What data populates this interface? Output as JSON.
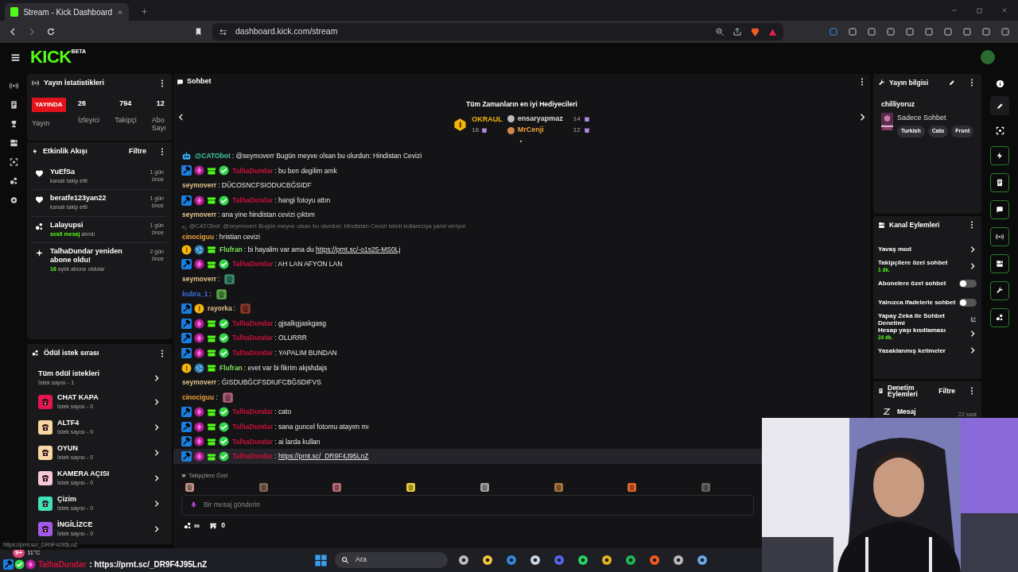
{
  "browser": {
    "tab_title": "Stream - Kick Dashboard",
    "url": "dashboard.kick.com/stream"
  },
  "header": {
    "logo": "KICK",
    "beta": "BETA"
  },
  "stats": {
    "title": "Yayın İstatistikleri",
    "live_badge": "YAYINDA",
    "live_label": "Yayın",
    "items": [
      {
        "value": "26",
        "label": "İzleyici"
      },
      {
        "value": "794",
        "label": "Takipçi"
      },
      {
        "value": "12",
        "label": "Abo Sayı"
      }
    ]
  },
  "activity": {
    "title": "Etkinlik Akışı",
    "filter": "Filtre",
    "items": [
      {
        "kind": "follow",
        "name": "YuEfSa",
        "sub": "kanalı takip etti",
        "time": "1 gün önce"
      },
      {
        "kind": "follow",
        "name": "beratfe123yan22",
        "sub": "kanalı takip etti",
        "time": "1 gün önce"
      },
      {
        "kind": "voice",
        "name": "Lalayupsi",
        "highlight": "sesli mesaj",
        "sub": "alındı",
        "time": "1 gün önce"
      },
      {
        "kind": "resub",
        "name": "TalhaDundar yeniden abone oldu!",
        "highlight": "16",
        "sub": "aylık abone oldular",
        "time": "2 gün önce"
      }
    ]
  },
  "rewards": {
    "title": "Ödül istek sırası",
    "all_label": "Tüm ödül istekleri",
    "all_count": "İstek sayısı - 1",
    "items": [
      {
        "name": "CHAT KAPA",
        "count": "İstek sayısı - 0",
        "color": "#e3164f"
      },
      {
        "name": "ALTF4",
        "count": "İstek sayısı - 0",
        "color": "#f6d7a1"
      },
      {
        "name": "OYUN",
        "count": "İstek sayısı - 0",
        "color": "#f6d7a1"
      },
      {
        "name": "KAMERA AÇISI",
        "count": "İstek sayısı - 0",
        "color": "#f7c7da"
      },
      {
        "name": "Çizim",
        "count": "İstek sayısı - 0",
        "color": "#3fe2b6"
      },
      {
        "name": "İNGİLİZCE",
        "count": "İstek sayısı - 0",
        "color": "#a35ae8"
      }
    ]
  },
  "chat": {
    "title": "Sohbet",
    "gifters_title": "Tüm Zamanların en iyi Hediyecileri",
    "gifters": [
      {
        "name": "OKRAUL",
        "count": "16",
        "kind": "gold"
      },
      {
        "name": "ensaryapmaz",
        "count": "14",
        "kind": "silver"
      },
      {
        "name": "MrCenji",
        "count": "12",
        "kind": "bronze"
      }
    ],
    "messages": [
      {
        "badges": [
          {
            "kind": "bot"
          }
        ],
        "user": "@CATObot",
        "color": "#3ec6a8",
        "text": ": @seymoverr Bugün meyve olsan bu olurdun: Hindistan Cevizi",
        "hovered": false
      },
      {
        "badges": [
          {
            "kind": "mod"
          },
          {
            "kind": "sub"
          },
          {
            "kind": "gift"
          },
          {
            "kind": "verified"
          }
        ],
        "user": "TalhaDundar",
        "color": "#c8103a",
        "text": ": bu ben degilim amk",
        "hovered": false
      },
      {
        "user": "seymoverr",
        "color": "#e2c089",
        "text": ": DÜCOSNCFSIODUCBĞSIDF",
        "hovered": false
      },
      {
        "badges": [
          {
            "kind": "mod"
          },
          {
            "kind": "sub"
          },
          {
            "kind": "gift"
          },
          {
            "kind": "verified"
          }
        ],
        "user": "TalhaDundar",
        "color": "#c8103a",
        "text": ": hangi fotoyu attın",
        "hovered": false
      },
      {
        "user": "seymoverr",
        "color": "#e2c089",
        "text": ": ana yine hindistan cevizi çıktım",
        "hovered": false
      },
      {
        "reply": "@CATObot: @seymoverr Bugün meyve olsan bu olurdun: Hindistan Cevizi isimli kullanıcıya yanıt veriyor",
        "user": "cinociguu",
        "color": "#f0a23a",
        "text": ": hristian cevizi",
        "hovered": false
      },
      {
        "badges": [
          {
            "kind": "gold"
          },
          {
            "kind": "globe"
          },
          {
            "kind": "gift"
          }
        ],
        "user": "Flufran",
        "color": "#7be05a",
        "text": ": bi hayalim var ama du",
        "link": "https://prnt.sc/-o1s25-MS0Lj",
        "hovered": false
      },
      {
        "badges": [
          {
            "kind": "mod"
          },
          {
            "kind": "sub"
          },
          {
            "kind": "gift"
          },
          {
            "kind": "verified"
          }
        ],
        "user": "TalhaDundar",
        "color": "#c8103a",
        "text": ": AH LAN AFYON LAN",
        "hovered": false
      },
      {
        "user": "seymoverr",
        "color": "#e2c089",
        "text": ":",
        "emote": {
          "color": "#3c8c6c"
        },
        "hovered": false
      },
      {
        "user": "kubra_1",
        "color": "#3b6fe0",
        "text": ":",
        "emote": {
          "color": "#5aa84a"
        },
        "hovered": false
      },
      {
        "badges": [
          {
            "kind": "mod"
          },
          {
            "kind": "gold"
          }
        ],
        "user": "rayorka",
        "color": "#e2c089",
        "text": ":",
        "emote": {
          "color": "#8a3a2a"
        },
        "hovered": false
      },
      {
        "badges": [
          {
            "kind": "mod"
          },
          {
            "kind": "sub"
          },
          {
            "kind": "gift"
          },
          {
            "kind": "verified"
          }
        ],
        "user": "TalhaDundar",
        "color": "#c8103a",
        "text": ": gjsalkgjaskgasg",
        "hovered": false
      },
      {
        "badges": [
          {
            "kind": "mod"
          },
          {
            "kind": "sub"
          },
          {
            "kind": "gift"
          },
          {
            "kind": "verified"
          }
        ],
        "user": "TalhaDundar",
        "color": "#c8103a",
        "text": ": OLURRR",
        "hovered": false
      },
      {
        "badges": [
          {
            "kind": "mod"
          },
          {
            "kind": "sub"
          },
          {
            "kind": "gift"
          },
          {
            "kind": "verified"
          }
        ],
        "user": "TalhaDundar",
        "color": "#c8103a",
        "text": ": YAPALIM BUNDAN",
        "hovered": false
      },
      {
        "badges": [
          {
            "kind": "gold"
          },
          {
            "kind": "globe"
          },
          {
            "kind": "gift"
          }
        ],
        "user": "Flufran",
        "color": "#7be05a",
        "text": ": evet var bi fikrim akjshdajs",
        "hovered": false
      },
      {
        "user": "seymoverr",
        "color": "#e2c089",
        "text": ": ĞISDUBĞCFSDIUFCBĞSDIFVS",
        "hovered": false
      },
      {
        "user": "cinociguu",
        "color": "#f0a23a",
        "text": ":",
        "emote": {
          "color": "#b0607a"
        },
        "hovered": false
      },
      {
        "badges": [
          {
            "kind": "mod"
          },
          {
            "kind": "sub"
          },
          {
            "kind": "gift"
          },
          {
            "kind": "verified"
          }
        ],
        "user": "TalhaDundar",
        "color": "#c8103a",
        "text": ": cato",
        "hovered": false
      },
      {
        "badges": [
          {
            "kind": "mod"
          },
          {
            "kind": "sub"
          },
          {
            "kind": "gift"
          },
          {
            "kind": "verified"
          }
        ],
        "user": "TalhaDundar",
        "color": "#c8103a",
        "text": ": sana guncel fotomu atayım mı",
        "hovered": false
      },
      {
        "badges": [
          {
            "kind": "mod"
          },
          {
            "kind": "sub"
          },
          {
            "kind": "gift"
          },
          {
            "kind": "verified"
          }
        ],
        "user": "TalhaDundar",
        "color": "#c8103a",
        "text": ": ai larda kullan",
        "hovered": false
      },
      {
        "badges": [
          {
            "kind": "mod"
          },
          {
            "kind": "sub"
          },
          {
            "kind": "gift"
          },
          {
            "kind": "verified"
          }
        ],
        "user": "TalhaDundar",
        "color": "#c8103a",
        "text": ":",
        "link": "https://prnt.sc/_DR9F4J95LnZ",
        "hovered": true
      }
    ],
    "followers_label": "Takipçilere Özel",
    "emotes": [
      {
        "color": "#c79a8a"
      },
      {
        "color": "#8a6a5a"
      },
      {
        "color": "#c0707a"
      },
      {
        "color": "#f2d53c"
      },
      {
        "color": "#a8a8a8"
      },
      {
        "color": "#b07a40"
      },
      {
        "color": "#f06a2a"
      },
      {
        "color": "#6a6a6a"
      }
    ],
    "input_placeholder": "Bir mesaj gönderin",
    "points": "∞",
    "store_count": "0"
  },
  "stream_info": {
    "title": "Yayın bilgisi",
    "channel": "chilliyoruz",
    "category": "Sadece Sohbet",
    "tags": [
      "Turkish",
      "Cato",
      "Front"
    ]
  },
  "channel_actions": {
    "title": "Kanal Eylemleri",
    "items": [
      {
        "kind": "link",
        "label": "Yavaş mod"
      },
      {
        "kind": "link",
        "label": "Takipçilere özel sohbet",
        "sub": "1 dk."
      },
      {
        "kind": "toggle",
        "label": "Abonelere özel sohbet",
        "on": false
      },
      {
        "kind": "toggle",
        "label": "Yalnızca ifadelerle sohbet",
        "on": false
      },
      {
        "kind": "external",
        "label": "Yapay Zeka ile Sohbet Denetimi"
      },
      {
        "kind": "link",
        "label": "Hesap yaşı kısıtlaması",
        "sub": "24 dk."
      },
      {
        "kind": "link",
        "label": "Yasaklanmış kelimeler"
      }
    ]
  },
  "moderation": {
    "title": "Denetim Eylemleri",
    "filter": "Filtre",
    "items": [
      {
        "label": "Mesaj",
        "time": "22 saat"
      }
    ]
  },
  "status_url": "https://prnt.sc/_DR9F4J95LnZ",
  "overlay": {
    "badges": [
      {
        "kind": "mod"
      },
      {
        "kind": "verified"
      },
      {
        "kind": "sub"
      }
    ],
    "user": "TalhaDundar",
    "text": ": https://prnt.sc/_DR9F4J95LnZ"
  },
  "taskbar": {
    "weather": "11°C",
    "weather_badge": "9+",
    "search": "Ara"
  }
}
